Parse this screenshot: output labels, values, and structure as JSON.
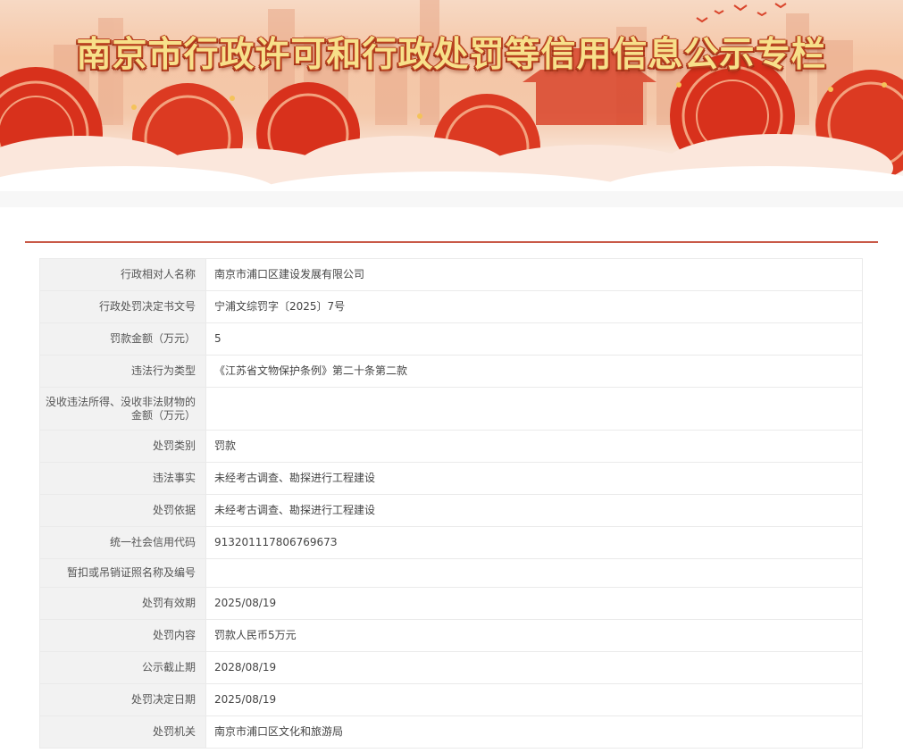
{
  "banner": {
    "title": "南京市行政许可和行政处罚等信用信息公示专栏"
  },
  "colors": {
    "accent_red": "#c95a48",
    "title_gold": "#f7e08a",
    "label_bg": "#f2f2f2"
  },
  "record": {
    "rows": [
      {
        "label": "行政相对人名称",
        "value": "南京市浦口区建设发展有限公司"
      },
      {
        "label": "行政处罚决定书文号",
        "value": "宁浦文综罚字〔2025〕7号"
      },
      {
        "label": "罚款金额（万元）",
        "value": "5"
      },
      {
        "label": "违法行为类型",
        "value": "《江苏省文物保护条例》第二十条第二款"
      },
      {
        "label": "没收违法所得、没收非法财物的金额（万元）",
        "value": ""
      },
      {
        "label": "处罚类别",
        "value": "罚款"
      },
      {
        "label": "违法事实",
        "value": "未经考古调查、勘探进行工程建设"
      },
      {
        "label": "处罚依据",
        "value": "未经考古调查、勘探进行工程建设"
      },
      {
        "label": "统一社会信用代码",
        "value": "91320111780676967З"
      },
      {
        "label": "暂扣或吊销证照名称及编号",
        "value": ""
      },
      {
        "label": "处罚有效期",
        "value": "2025/08/19"
      },
      {
        "label": "处罚内容",
        "value": "罚款人民币5万元"
      },
      {
        "label": "公示截止期",
        "value": "2028/08/19"
      },
      {
        "label": "处罚决定日期",
        "value": "2025/08/19"
      },
      {
        "label": "处罚机关",
        "value": "南京市浦口区文化和旅游局"
      }
    ]
  }
}
